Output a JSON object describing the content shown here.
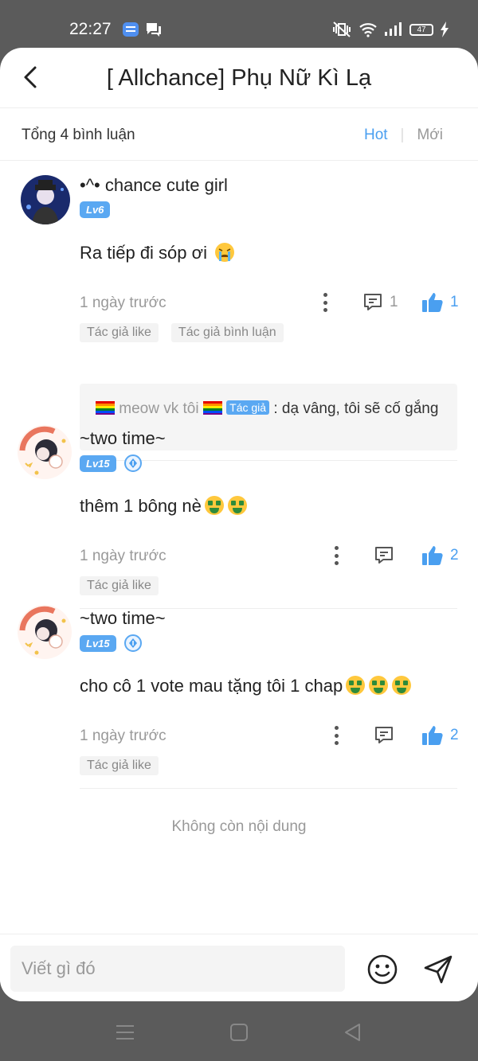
{
  "status": {
    "time": "22:27",
    "battery": "47"
  },
  "header": {
    "title": "[ Allchance] Phụ Nữ Kì Lạ"
  },
  "subbar": {
    "total": "Tổng 4 bình luận",
    "sort_hot": "Hot",
    "sort_new": "Mới"
  },
  "colors": {
    "accent": "#4a9ff0",
    "badge": "#5aa8f2"
  },
  "comments": [
    {
      "username": "•^• chance cute girl",
      "level": "Lv6",
      "text": "Ra tiếp đi sóp ơi",
      "emoji": "crying-face",
      "time": "1 ngày trước",
      "reply_count": "1",
      "like_count": "1",
      "tags": [
        "Tác giả like",
        "Tác giả bình luận"
      ],
      "reply": {
        "name": "meow vk tôi",
        "badge": "Tác giả",
        "text": ": dạ vâng, tôi sẽ cố gắng"
      }
    },
    {
      "username": "~two time~",
      "level": "Lv15",
      "text": "thêm 1 bông nè",
      "emoji": "money-mouth-face",
      "time": "1 ngày trước",
      "like_count": "2",
      "tags": [
        "Tác giả like"
      ]
    },
    {
      "username": "~two time~",
      "level": "Lv15",
      "text": "cho cô 1 vote mau tặng tôi 1 chap",
      "emoji": "money-mouth-face",
      "time": "1 ngày trước",
      "like_count": "2",
      "tags": [
        "Tác giả like"
      ]
    }
  ],
  "footer": {
    "no_more": "Không còn nội dung"
  },
  "composer": {
    "placeholder": "Viết gì đó"
  }
}
